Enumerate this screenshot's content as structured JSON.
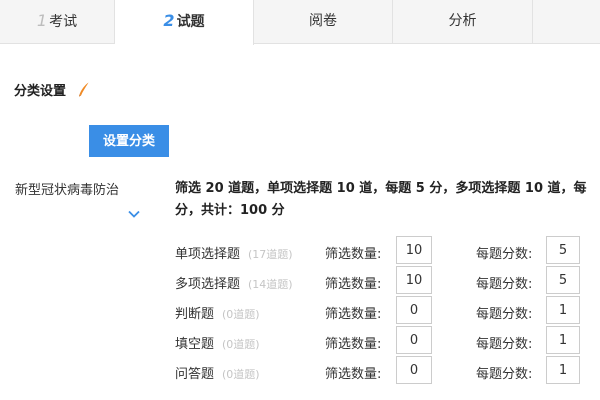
{
  "tabs": [
    {
      "num": "1",
      "label": "考试"
    },
    {
      "num": "2",
      "label": "试题"
    },
    {
      "num": "",
      "label": "阅卷"
    },
    {
      "num": "",
      "label": "分析"
    }
  ],
  "section": {
    "title": "分类设置",
    "icon": "pencil-icon"
  },
  "set_category_button": "设置分类",
  "category": {
    "name": "新型冠状病毒防治",
    "summary_line1": "筛选 20 道题，单项选择题 10 道，每题 5 分，多项选择题 10 道，每",
    "summary_line2": "分，共计：100 分"
  },
  "question_rows": [
    {
      "type": "单项选择题",
      "count": "(17道题)",
      "filter_label": "筛选数量:",
      "filter_value": "10",
      "score_label": "每题分数:",
      "score_value": "5"
    },
    {
      "type": "多项选择题",
      "count": "(14道题)",
      "filter_label": "筛选数量:",
      "filter_value": "10",
      "score_label": "每题分数:",
      "score_value": "5"
    },
    {
      "type": "判断题",
      "count": "(0道题)",
      "filter_label": "筛选数量:",
      "filter_value": "0",
      "score_label": "每题分数:",
      "score_value": "1"
    },
    {
      "type": "填空题",
      "count": "(0道题)",
      "filter_label": "筛选数量:",
      "filter_value": "0",
      "score_label": "每题分数:",
      "score_value": "1"
    },
    {
      "type": "问答题",
      "count": "(0道题)",
      "filter_label": "筛选数量:",
      "filter_value": "0",
      "score_label": "每题分数:",
      "score_value": "1"
    }
  ],
  "colors": {
    "accent": "#3a8ee6",
    "pencil": "#f08a24"
  }
}
